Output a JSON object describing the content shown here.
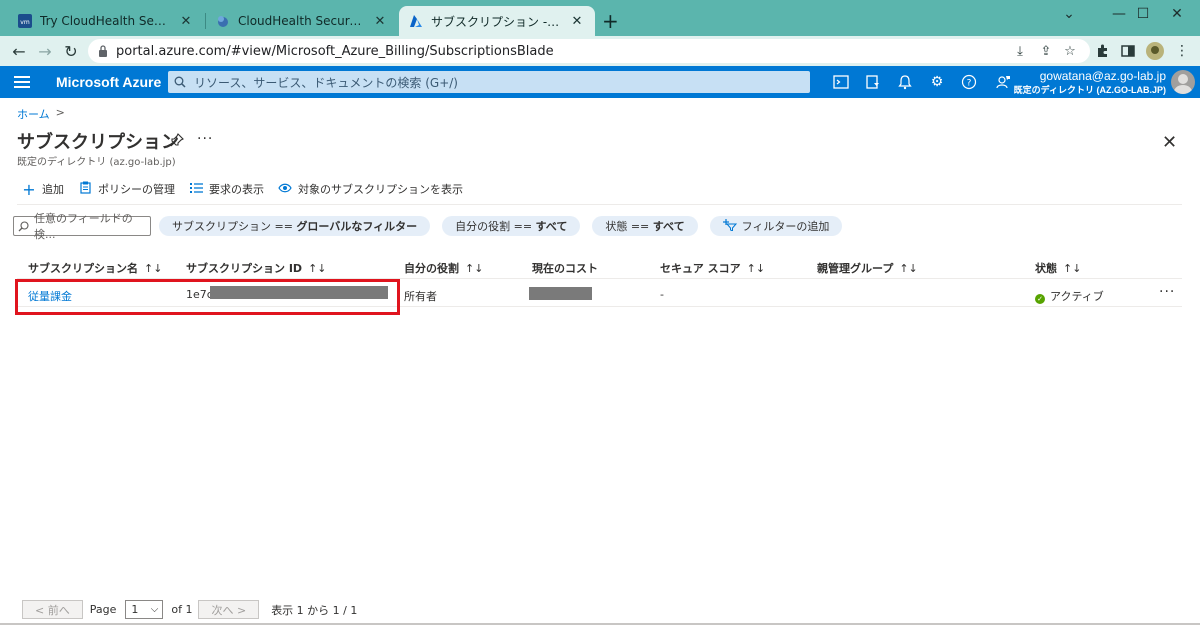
{
  "browser": {
    "tabs": [
      {
        "title": "Try CloudHealth Secure State for",
        "icon": "vmware-icon"
      },
      {
        "title": "CloudHealth Secure State",
        "icon": "cloudhealth-icon"
      },
      {
        "title": "サブスクリプション - Microsoft Azure",
        "icon": "azure-icon"
      }
    ],
    "url": "portal.azure.com/#view/Microsoft_Azure_Billing/SubscriptionsBlade"
  },
  "azure": {
    "brand": "Microsoft Azure",
    "search_placeholder": "リソース、サービス、ドキュメントの検索 (G+/)",
    "account_user": "gowatana@az.go-lab.jp",
    "account_directory": "既定のディレクトリ (AZ.GO-LAB.JP)"
  },
  "page": {
    "breadcrumb_home": "ホーム",
    "breadcrumb_sep": ">",
    "title": "サブスクリプション",
    "subtitle": "既定のディレクトリ (az.go-lab.jp)",
    "commands": {
      "add": "追加",
      "policy": "ポリシーの管理",
      "requirements": "要求の表示",
      "view_target": "対象のサブスクリプションを表示"
    },
    "filter_placeholder": "任意のフィールドの検...",
    "filters": {
      "sub_label": "サブスクリプション == ",
      "sub_value": "グローバルなフィルター",
      "role_label": "自分の役割 == ",
      "role_value": "すべて",
      "state_label": "状態 == ",
      "state_value": "すべて",
      "add_filter": "フィルターの追加"
    }
  },
  "table": {
    "columns": [
      "サブスクリプション名",
      "サブスクリプション ID",
      "自分の役割",
      "現在のコスト",
      "セキュア スコア",
      "親管理グループ",
      "状態"
    ],
    "sort_glyph": "↑↓",
    "rows": [
      {
        "name": "従量課金",
        "id_prefix": "1e7c",
        "role": "所有者",
        "secure_score": "-",
        "management_group": "",
        "state": "アクティブ"
      }
    ]
  },
  "pager": {
    "prev": "< 前へ",
    "page_label": "Page",
    "page_value": "1",
    "of": "of 1",
    "next": "次へ >",
    "summary": "表示 1 から 1 / 1"
  },
  "colors": {
    "azure_blue": "#0078d4",
    "tab_bar": "#5bb5ad",
    "highlight_red": "#e0141e",
    "status_green": "#57a300"
  }
}
